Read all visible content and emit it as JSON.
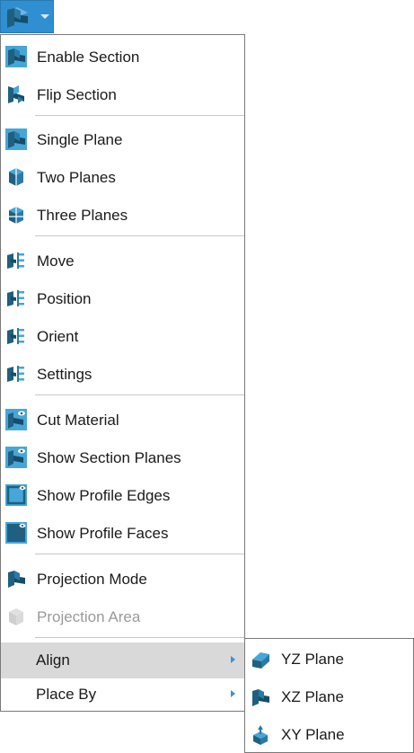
{
  "toolbar": {
    "main_icon": "section-plane-icon",
    "dropdown_icon": "chevron-down-icon"
  },
  "menu": {
    "items": [
      {
        "label": "Enable Section",
        "icon": "enable-section-icon",
        "enabled": true
      },
      {
        "label": "Flip Section",
        "icon": "flip-section-icon",
        "enabled": true
      },
      {
        "label": "Single Plane",
        "icon": "single-plane-icon",
        "enabled": true
      },
      {
        "label": "Two Planes",
        "icon": "two-planes-icon",
        "enabled": true
      },
      {
        "label": "Three Planes",
        "icon": "three-planes-icon",
        "enabled": true
      },
      {
        "label": "Move",
        "icon": "move-icon",
        "enabled": true
      },
      {
        "label": "Position",
        "icon": "position-icon",
        "enabled": true
      },
      {
        "label": "Orient",
        "icon": "orient-icon",
        "enabled": true
      },
      {
        "label": "Settings",
        "icon": "settings-icon",
        "enabled": true
      },
      {
        "label": "Cut Material",
        "icon": "cut-material-icon",
        "enabled": true
      },
      {
        "label": "Show Section Planes",
        "icon": "show-section-planes-icon",
        "enabled": true
      },
      {
        "label": "Show Profile Edges",
        "icon": "show-profile-edges-icon",
        "enabled": true
      },
      {
        "label": "Show Profile Faces",
        "icon": "show-profile-faces-icon",
        "enabled": true
      },
      {
        "label": "Projection Mode",
        "icon": "projection-mode-icon",
        "enabled": true
      },
      {
        "label": "Projection Area",
        "icon": "projection-area-icon",
        "enabled": false
      }
    ],
    "submenus": [
      {
        "label": "Align",
        "highlighted": true
      },
      {
        "label": "Place By",
        "highlighted": false
      }
    ]
  },
  "align_submenu": {
    "items": [
      {
        "label": "YZ Plane",
        "icon": "yz-plane-icon"
      },
      {
        "label": "XZ Plane",
        "icon": "xz-plane-icon"
      },
      {
        "label": "XY Plane",
        "icon": "xy-plane-icon"
      }
    ]
  },
  "colors": {
    "accent": "#2f8fd1",
    "icon_dark": "#1f5f7f",
    "icon_light": "#46a6d8",
    "highlight": "#d9d9d9",
    "disabled": "#9a9a9a"
  }
}
